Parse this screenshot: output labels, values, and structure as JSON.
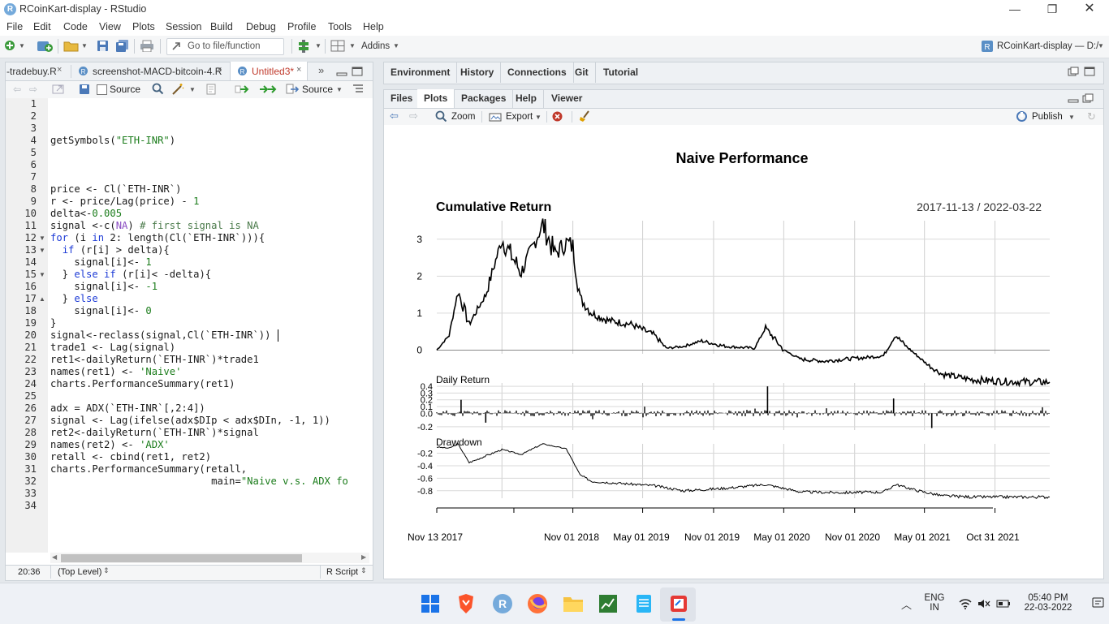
{
  "window": {
    "title": "RCoinKart-display - RStudio"
  },
  "menubar": [
    "File",
    "Edit",
    "Code",
    "View",
    "Plots",
    "Session",
    "Build",
    "Debug",
    "Profile",
    "Tools",
    "Help"
  ],
  "toolbar": {
    "goto_placeholder": "Go to file/function",
    "addins_label": "Addins",
    "project_label": "RCoinKart-display — D:/"
  },
  "editor": {
    "tabs": [
      "-tradebuy.R",
      "screenshot-MACD-bitcoin-4.R",
      "Untitled3*"
    ],
    "source_on_save_label": "Source",
    "source_button_label": "Source",
    "line_numbers": [
      "1",
      "2",
      "3",
      "4",
      "5",
      "6",
      "7",
      "8",
      "9",
      "10",
      "11",
      "12",
      "13",
      "14",
      "15",
      "16",
      "17",
      "18",
      "19",
      "20",
      "21",
      "22",
      "23",
      "24",
      "25",
      "26",
      "27",
      "28",
      "29",
      "30",
      "31",
      "32",
      "33",
      "34"
    ],
    "status": {
      "cursor": "20:36",
      "scope": "(Top Level)",
      "filetype": "R Script"
    }
  },
  "env_pane": {
    "tabs": [
      "Environment",
      "History",
      "Connections",
      "Git",
      "Tutorial"
    ]
  },
  "plots_pane": {
    "tabs": [
      "Files",
      "Plots",
      "Packages",
      "Help",
      "Viewer"
    ],
    "zoom_label": "Zoom",
    "export_label": "Export",
    "publish_label": "Publish"
  },
  "chart_data": {
    "type": "line",
    "title": "Naive Performance",
    "panels": [
      {
        "name": "Cumulative Return",
        "yticks": [
          0,
          1,
          2,
          3
        ],
        "ylim": [
          -0.1,
          3.5
        ]
      },
      {
        "name": "Daily Return",
        "yticks": [
          -0.2,
          0.0,
          0.1,
          0.2,
          0.3,
          0.4
        ],
        "ylim": [
          -0.25,
          0.45
        ]
      },
      {
        "name": "Drawdown",
        "yticks": [
          -0.2,
          -0.4,
          -0.6,
          -0.8
        ],
        "ylim": [
          -0.92,
          -0.05
        ]
      }
    ],
    "date_range": "2017-11-13 / 2022-03-22",
    "x_tick_labels": [
      "Nov 13 2017",
      "Nov 01 2018",
      "May 01 2019",
      "Nov 01 2019",
      "May 01 2020",
      "Nov 01 2020",
      "May 01 2021",
      "Oct 31 2021"
    ],
    "cumulative_return": {
      "x": [
        "2017-11-13",
        "2017-12-15",
        "2018-01-07",
        "2018-02-05",
        "2018-03-20",
        "2018-05-01",
        "2018-06-20",
        "2018-08-15",
        "2018-09-15",
        "2018-10-15",
        "2018-11-01",
        "2018-11-20",
        "2018-12-20",
        "2019-02-01",
        "2019-04-01",
        "2019-06-01",
        "2019-07-01",
        "2019-08-15",
        "2019-10-01",
        "2019-12-01",
        "2020-02-15",
        "2020-03-15",
        "2020-05-01",
        "2020-06-15",
        "2020-08-15",
        "2020-10-01",
        "2020-12-01",
        "2021-01-15",
        "2021-02-15",
        "2021-03-15",
        "2021-05-10",
        "2021-06-15",
        "2021-09-01",
        "2021-12-01",
        "2022-03-22"
      ],
      "y": [
        0.0,
        0.4,
        1.6,
        0.7,
        1.5,
        3.0,
        2.1,
        3.4,
        2.6,
        2.9,
        2.8,
        1.4,
        1.0,
        0.8,
        0.7,
        0.4,
        0.05,
        0.1,
        0.25,
        0.1,
        0.05,
        0.6,
        0.0,
        -0.25,
        -0.3,
        -0.25,
        -0.2,
        -0.15,
        0.4,
        0.1,
        -0.4,
        -0.65,
        -0.8,
        -0.85,
        -0.87
      ]
    },
    "drawdown": {
      "x": [
        "2017-11-13",
        "2017-12-15",
        "2018-01-07",
        "2018-02-05",
        "2018-05-01",
        "2018-06-20",
        "2018-08-15",
        "2018-10-15",
        "2018-11-20",
        "2018-12-20",
        "2019-03-01",
        "2019-06-01",
        "2019-08-15",
        "2019-12-01",
        "2020-03-15",
        "2020-06-15",
        "2020-10-01",
        "2021-01-15",
        "2021-02-15",
        "2021-04-15",
        "2021-06-15",
        "2021-09-01",
        "2022-03-22"
      ],
      "y": [
        -0.1,
        -0.12,
        -0.05,
        -0.35,
        -0.14,
        -0.22,
        -0.05,
        -0.13,
        -0.55,
        -0.65,
        -0.68,
        -0.72,
        -0.8,
        -0.76,
        -0.7,
        -0.82,
        -0.83,
        -0.82,
        -0.7,
        -0.8,
        -0.88,
        -0.9,
        -0.9
      ]
    }
  }
}
